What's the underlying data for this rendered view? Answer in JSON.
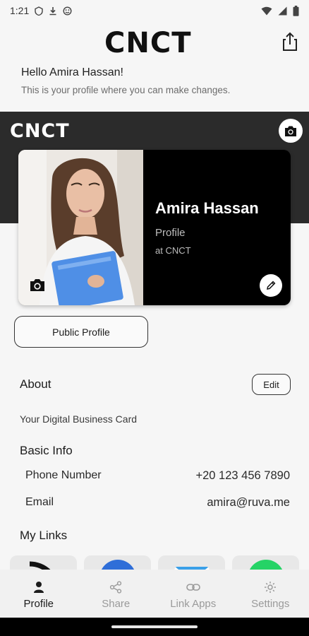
{
  "status": {
    "time": "1:21",
    "left_icons": [
      "vpn-icon",
      "download-icon",
      "smiley-icon"
    ],
    "right_icons": [
      "wifi-icon",
      "signal-icon",
      "battery-icon"
    ]
  },
  "header": {
    "logo_text": "CNCT"
  },
  "greeting": "Hello  Amira Hassan!",
  "subtitle": "This is your profile where you can make changes.",
  "cover": {
    "logo_text": "CNCT"
  },
  "card": {
    "name": "Amira Hassan",
    "role": "Profile",
    "company": "at CNCT"
  },
  "public_profile_label": "Public Profile",
  "about": {
    "title": "About",
    "edit_label": "Edit",
    "text": "Your Digital Business Card"
  },
  "basic_info": {
    "title": "Basic Info",
    "rows": [
      {
        "label": "Phone Number",
        "value": "+20 123 456 7890"
      },
      {
        "label": "Email",
        "value": "amira@ruva.me"
      }
    ]
  },
  "links": {
    "title": "My Links",
    "tiles": [
      "rss-icon",
      "messenger-icon",
      "mail-icon",
      "whatsapp-icon"
    ]
  },
  "nav": {
    "items": [
      {
        "label": "Profile",
        "icon": "person-icon",
        "active": true
      },
      {
        "label": "Share",
        "icon": "share-nodes-icon",
        "active": false
      },
      {
        "label": "Link Apps",
        "icon": "link-icon",
        "active": false
      },
      {
        "label": "Settings",
        "icon": "gear-icon",
        "active": false
      }
    ]
  },
  "colors": {
    "cover_bg": "#2b2b2b",
    "card_bg": "#000000",
    "accent_blue": "#2f6ed8",
    "mail_blue": "#3aa0e8",
    "whatsapp_green": "#25d366"
  }
}
